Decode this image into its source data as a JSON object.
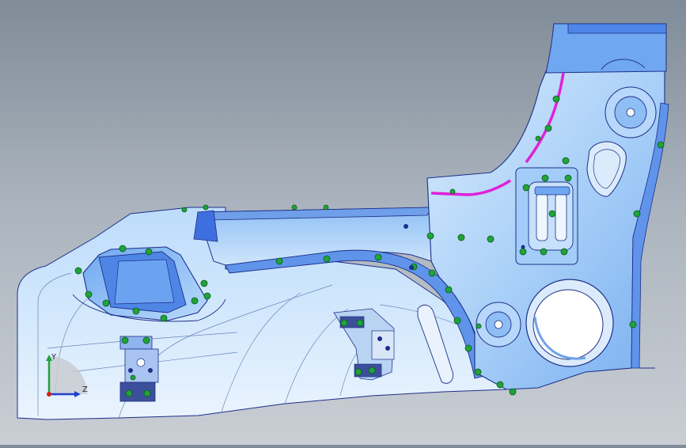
{
  "triad": {
    "y_label": "Y",
    "z_label": "Z"
  },
  "colors": {
    "part_fill": "#9cc8f7",
    "part_light": "#cfe4fb",
    "part_shadow": "#6fa2e6",
    "edge": "#1d2f8a",
    "bracket": "#3c4f9a",
    "weld_point": "#1fa33a",
    "curve_accent": "#e020d8"
  }
}
